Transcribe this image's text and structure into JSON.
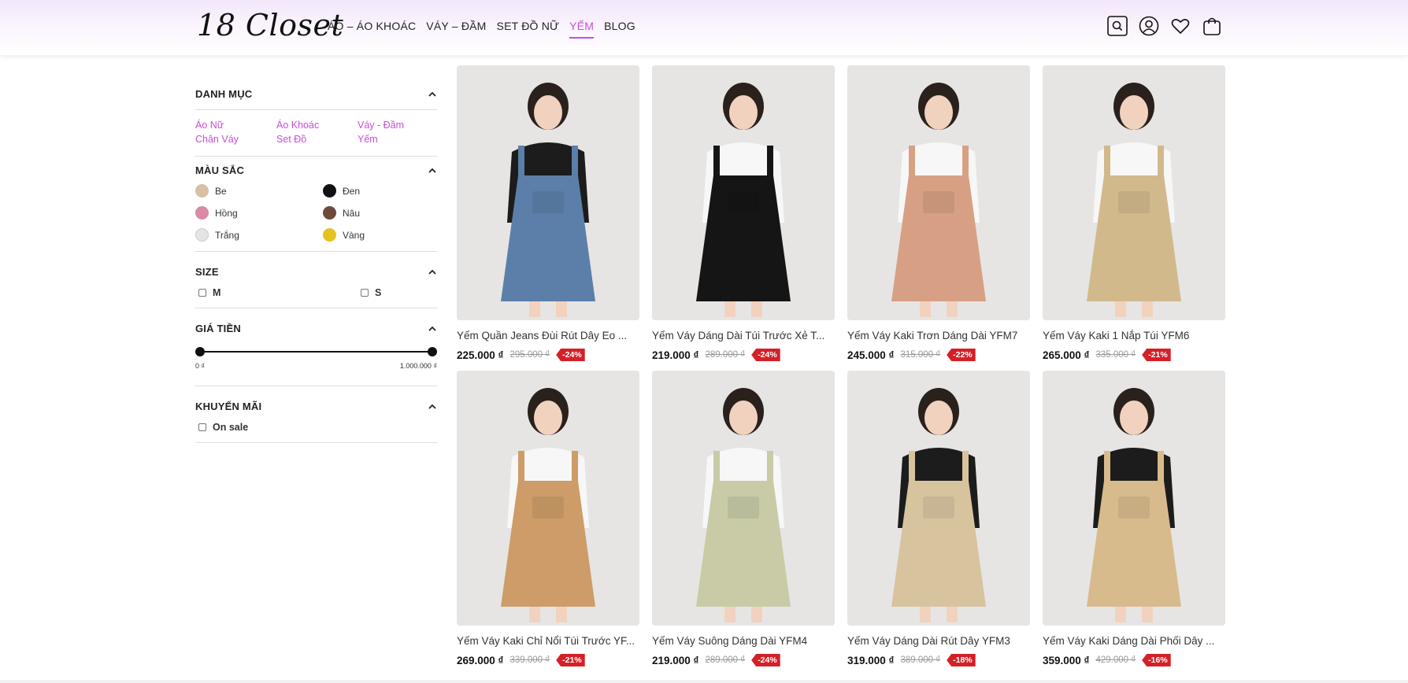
{
  "header": {
    "logo": "18 Closet",
    "nav": [
      {
        "label": "ÁO – ÁO KHOÁC",
        "active": false
      },
      {
        "label": "VÁY – ĐẦM",
        "active": false
      },
      {
        "label": "SET ĐỒ NỮ",
        "active": false
      },
      {
        "label": "YẾM",
        "active": true
      },
      {
        "label": "BLOG",
        "active": false
      }
    ],
    "icons": [
      "search-icon",
      "user-icon",
      "heart-icon",
      "cart-icon"
    ]
  },
  "filters": {
    "category": {
      "title": "DANH MỤC",
      "items": [
        "Áo Nữ",
        "Áo Khoác",
        "Váy - Đầm",
        "Chân Váy",
        "Set Đồ",
        "Yếm"
      ]
    },
    "color": {
      "title": "MÀU SẮC",
      "items": [
        {
          "label": "Be",
          "color": "#d9bfa6"
        },
        {
          "label": "Đen",
          "color": "#111111"
        },
        {
          "label": "Hồng",
          "color": "#d98aa7"
        },
        {
          "label": "Nâu",
          "color": "#6e4a3a"
        },
        {
          "label": "Trắng",
          "color": "#e4e4e4"
        },
        {
          "label": "Vàng",
          "color": "#e6c21e"
        }
      ]
    },
    "size": {
      "title": "SIZE",
      "items": [
        "M",
        "S"
      ]
    },
    "price": {
      "title": "GIÁ TIỀN",
      "min_label": "0 ₫",
      "max_label": "1.000.000 ₫",
      "range": [
        0,
        1
      ]
    },
    "promo": {
      "title": "KHUYẾN MÃI",
      "items": [
        "On sale"
      ]
    }
  },
  "accent": "#c84dd8",
  "badge_color": "#d42027",
  "products": [
    {
      "name": "Yếm Quần Jeans Đùi Rút Dây Eo ...",
      "price": "225.000 ₫",
      "old_price": "295.000 ₫",
      "discount": "-24%",
      "garment": "#5b7fa8",
      "top": "#1c1c1c"
    },
    {
      "name": "Yếm Váy Dáng Dài Túi Trước Xẻ T...",
      "price": "219.000 ₫",
      "old_price": "289.000 ₫",
      "discount": "-24%",
      "garment": "#151515",
      "top": "#f7f7f7"
    },
    {
      "name": "Yếm Váy Kaki Trơn Dáng Dài YFM7",
      "price": "245.000 ₫",
      "old_price": "315.000 ₫",
      "discount": "-22%",
      "garment": "#d7a084",
      "top": "#f7f7f7"
    },
    {
      "name": "Yếm Váy Kaki 1 Nắp Túi YFM6",
      "price": "265.000 ₫",
      "old_price": "335.000 ₫",
      "discount": "-21%",
      "garment": "#d2b98c",
      "top": "#f7f7f7"
    },
    {
      "name": "Yếm Váy Kaki Chỉ Nổi Túi Trước YF...",
      "price": "269.000 ₫",
      "old_price": "339.000 ₫",
      "discount": "-21%",
      "garment": "#cd9c68",
      "top": "#f7f7f7"
    },
    {
      "name": "Yếm Váy Suông Dáng Dài YFM4",
      "price": "219.000 ₫",
      "old_price": "289.000 ₫",
      "discount": "-24%",
      "garment": "#c8cba6",
      "top": "#f7f7f7"
    },
    {
      "name": "Yếm Váy Dáng Dài Rút Dây YFM3",
      "price": "319.000 ₫",
      "old_price": "389.000 ₫",
      "discount": "-18%",
      "garment": "#d8c39f",
      "top": "#1c1c1c"
    },
    {
      "name": "Yếm Váy Kaki Dáng Dài Phối Dây ...",
      "price": "359.000 ₫",
      "old_price": "429.000 ₫",
      "discount": "-16%",
      "garment": "#d8bb8c",
      "top": "#1c1c1c"
    }
  ]
}
